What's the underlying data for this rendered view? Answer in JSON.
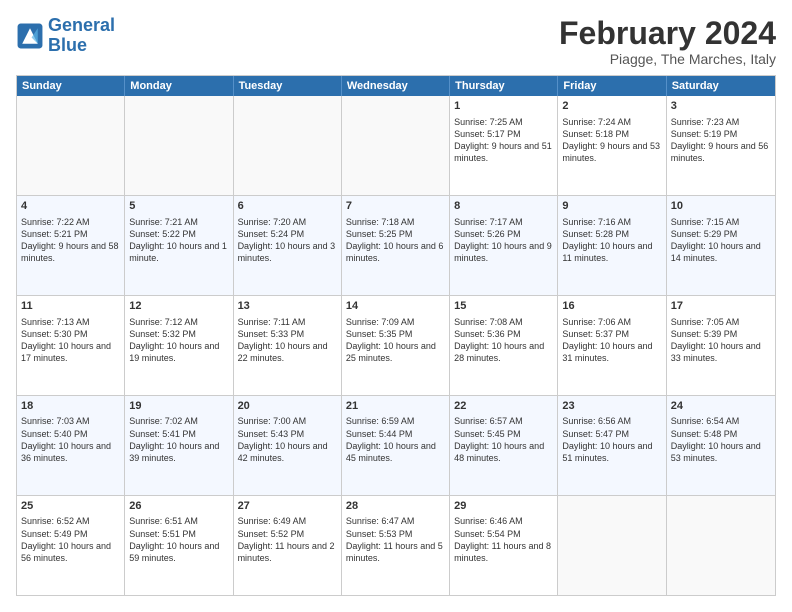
{
  "logo": {
    "text_general": "General",
    "text_blue": "Blue"
  },
  "header": {
    "title": "February 2024",
    "subtitle": "Piagge, The Marches, Italy"
  },
  "weekdays": [
    "Sunday",
    "Monday",
    "Tuesday",
    "Wednesday",
    "Thursday",
    "Friday",
    "Saturday"
  ],
  "weeks": [
    [
      {
        "day": "",
        "sunrise": "",
        "sunset": "",
        "daylight": ""
      },
      {
        "day": "",
        "sunrise": "",
        "sunset": "",
        "daylight": ""
      },
      {
        "day": "",
        "sunrise": "",
        "sunset": "",
        "daylight": ""
      },
      {
        "day": "",
        "sunrise": "",
        "sunset": "",
        "daylight": ""
      },
      {
        "day": "1",
        "sunrise": "Sunrise: 7:25 AM",
        "sunset": "Sunset: 5:17 PM",
        "daylight": "Daylight: 9 hours and 51 minutes."
      },
      {
        "day": "2",
        "sunrise": "Sunrise: 7:24 AM",
        "sunset": "Sunset: 5:18 PM",
        "daylight": "Daylight: 9 hours and 53 minutes."
      },
      {
        "day": "3",
        "sunrise": "Sunrise: 7:23 AM",
        "sunset": "Sunset: 5:19 PM",
        "daylight": "Daylight: 9 hours and 56 minutes."
      }
    ],
    [
      {
        "day": "4",
        "sunrise": "Sunrise: 7:22 AM",
        "sunset": "Sunset: 5:21 PM",
        "daylight": "Daylight: 9 hours and 58 minutes."
      },
      {
        "day": "5",
        "sunrise": "Sunrise: 7:21 AM",
        "sunset": "Sunset: 5:22 PM",
        "daylight": "Daylight: 10 hours and 1 minute."
      },
      {
        "day": "6",
        "sunrise": "Sunrise: 7:20 AM",
        "sunset": "Sunset: 5:24 PM",
        "daylight": "Daylight: 10 hours and 3 minutes."
      },
      {
        "day": "7",
        "sunrise": "Sunrise: 7:18 AM",
        "sunset": "Sunset: 5:25 PM",
        "daylight": "Daylight: 10 hours and 6 minutes."
      },
      {
        "day": "8",
        "sunrise": "Sunrise: 7:17 AM",
        "sunset": "Sunset: 5:26 PM",
        "daylight": "Daylight: 10 hours and 9 minutes."
      },
      {
        "day": "9",
        "sunrise": "Sunrise: 7:16 AM",
        "sunset": "Sunset: 5:28 PM",
        "daylight": "Daylight: 10 hours and 11 minutes."
      },
      {
        "day": "10",
        "sunrise": "Sunrise: 7:15 AM",
        "sunset": "Sunset: 5:29 PM",
        "daylight": "Daylight: 10 hours and 14 minutes."
      }
    ],
    [
      {
        "day": "11",
        "sunrise": "Sunrise: 7:13 AM",
        "sunset": "Sunset: 5:30 PM",
        "daylight": "Daylight: 10 hours and 17 minutes."
      },
      {
        "day": "12",
        "sunrise": "Sunrise: 7:12 AM",
        "sunset": "Sunset: 5:32 PM",
        "daylight": "Daylight: 10 hours and 19 minutes."
      },
      {
        "day": "13",
        "sunrise": "Sunrise: 7:11 AM",
        "sunset": "Sunset: 5:33 PM",
        "daylight": "Daylight: 10 hours and 22 minutes."
      },
      {
        "day": "14",
        "sunrise": "Sunrise: 7:09 AM",
        "sunset": "Sunset: 5:35 PM",
        "daylight": "Daylight: 10 hours and 25 minutes."
      },
      {
        "day": "15",
        "sunrise": "Sunrise: 7:08 AM",
        "sunset": "Sunset: 5:36 PM",
        "daylight": "Daylight: 10 hours and 28 minutes."
      },
      {
        "day": "16",
        "sunrise": "Sunrise: 7:06 AM",
        "sunset": "Sunset: 5:37 PM",
        "daylight": "Daylight: 10 hours and 31 minutes."
      },
      {
        "day": "17",
        "sunrise": "Sunrise: 7:05 AM",
        "sunset": "Sunset: 5:39 PM",
        "daylight": "Daylight: 10 hours and 33 minutes."
      }
    ],
    [
      {
        "day": "18",
        "sunrise": "Sunrise: 7:03 AM",
        "sunset": "Sunset: 5:40 PM",
        "daylight": "Daylight: 10 hours and 36 minutes."
      },
      {
        "day": "19",
        "sunrise": "Sunrise: 7:02 AM",
        "sunset": "Sunset: 5:41 PM",
        "daylight": "Daylight: 10 hours and 39 minutes."
      },
      {
        "day": "20",
        "sunrise": "Sunrise: 7:00 AM",
        "sunset": "Sunset: 5:43 PM",
        "daylight": "Daylight: 10 hours and 42 minutes."
      },
      {
        "day": "21",
        "sunrise": "Sunrise: 6:59 AM",
        "sunset": "Sunset: 5:44 PM",
        "daylight": "Daylight: 10 hours and 45 minutes."
      },
      {
        "day": "22",
        "sunrise": "Sunrise: 6:57 AM",
        "sunset": "Sunset: 5:45 PM",
        "daylight": "Daylight: 10 hours and 48 minutes."
      },
      {
        "day": "23",
        "sunrise": "Sunrise: 6:56 AM",
        "sunset": "Sunset: 5:47 PM",
        "daylight": "Daylight: 10 hours and 51 minutes."
      },
      {
        "day": "24",
        "sunrise": "Sunrise: 6:54 AM",
        "sunset": "Sunset: 5:48 PM",
        "daylight": "Daylight: 10 hours and 53 minutes."
      }
    ],
    [
      {
        "day": "25",
        "sunrise": "Sunrise: 6:52 AM",
        "sunset": "Sunset: 5:49 PM",
        "daylight": "Daylight: 10 hours and 56 minutes."
      },
      {
        "day": "26",
        "sunrise": "Sunrise: 6:51 AM",
        "sunset": "Sunset: 5:51 PM",
        "daylight": "Daylight: 10 hours and 59 minutes."
      },
      {
        "day": "27",
        "sunrise": "Sunrise: 6:49 AM",
        "sunset": "Sunset: 5:52 PM",
        "daylight": "Daylight: 11 hours and 2 minutes."
      },
      {
        "day": "28",
        "sunrise": "Sunrise: 6:47 AM",
        "sunset": "Sunset: 5:53 PM",
        "daylight": "Daylight: 11 hours and 5 minutes."
      },
      {
        "day": "29",
        "sunrise": "Sunrise: 6:46 AM",
        "sunset": "Sunset: 5:54 PM",
        "daylight": "Daylight: 11 hours and 8 minutes."
      },
      {
        "day": "",
        "sunrise": "",
        "sunset": "",
        "daylight": ""
      },
      {
        "day": "",
        "sunrise": "",
        "sunset": "",
        "daylight": ""
      }
    ]
  ]
}
